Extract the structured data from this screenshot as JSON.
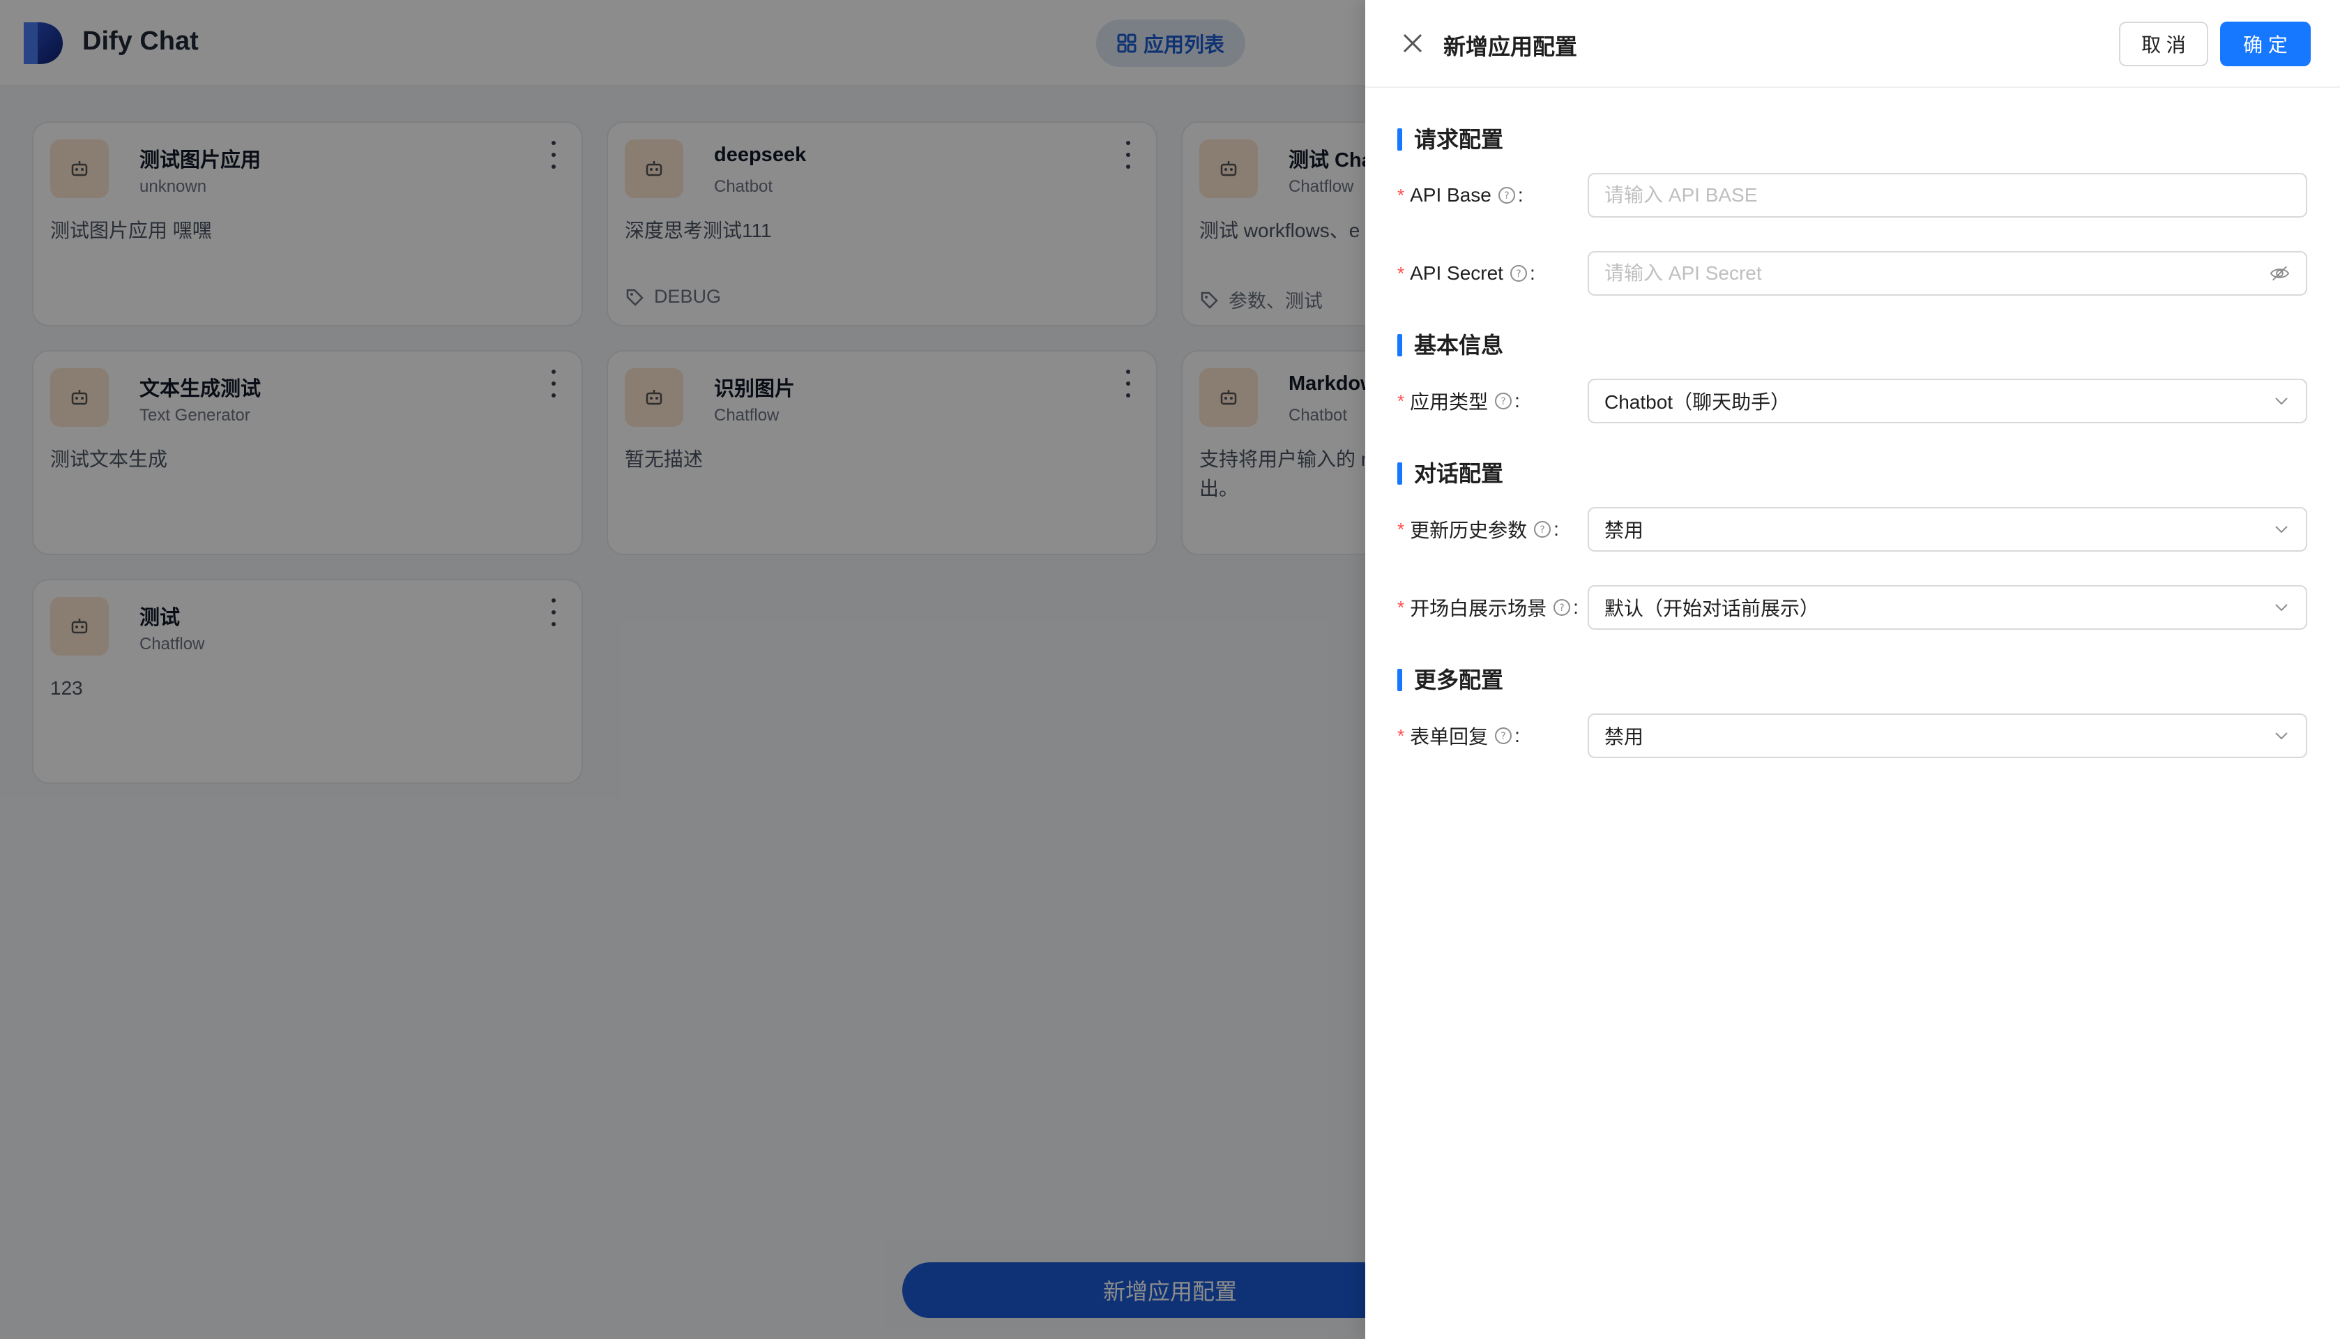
{
  "app": {
    "title": "Dify Chat",
    "nav_label": "应用列表",
    "add_button": "新增应用配置"
  },
  "cards": [
    {
      "name": "测试图片应用",
      "type": "unknown",
      "desc": "测试图片应用 嘿嘿",
      "tags": ""
    },
    {
      "name": "deepseek",
      "type": "Chatbot",
      "desc": "深度思考测试111",
      "tags": "DEBUG"
    },
    {
      "name": "测试 Chatf",
      "type": "Chatflow",
      "desc": "测试 workflows、e",
      "tags": "参数、测试"
    },
    {
      "name": "文本生成测试",
      "type": "Text Generator",
      "desc": "测试文本生成",
      "tags": ""
    },
    {
      "name": "识别图片",
      "type": "Chatflow",
      "desc": "暂无描述",
      "tags": ""
    },
    {
      "name": "Markdown",
      "type": "Chatbot",
      "desc": "支持将用户输入的 m\n出。",
      "tags": ""
    },
    {
      "name": "测试",
      "type": "Chatflow",
      "desc": "123",
      "tags": ""
    }
  ],
  "drawer": {
    "title": "新增应用配置",
    "cancel": "取 消",
    "ok": "确 定",
    "sections": {
      "request": "请求配置",
      "basic": "基本信息",
      "conversation": "对话配置",
      "more": "更多配置"
    },
    "fields": {
      "api_base": {
        "label": "API Base",
        "placeholder": "请输入 API BASE"
      },
      "api_secret": {
        "label": "API Secret",
        "placeholder": "请输入 API Secret"
      },
      "app_type": {
        "label": "应用类型",
        "value": "Chatbot（聊天助手）"
      },
      "update_history": {
        "label": "更新历史参数",
        "value": "禁用"
      },
      "opening_scene": {
        "label": "开场白展示场景",
        "value": "默认（开始对话前展示）"
      },
      "form_reply": {
        "label": "表单回复",
        "value": "禁用"
      }
    }
  },
  "colors": {
    "primary": "#1677ff",
    "required": "#ff4d4f",
    "section_bar": "#1677ff"
  }
}
